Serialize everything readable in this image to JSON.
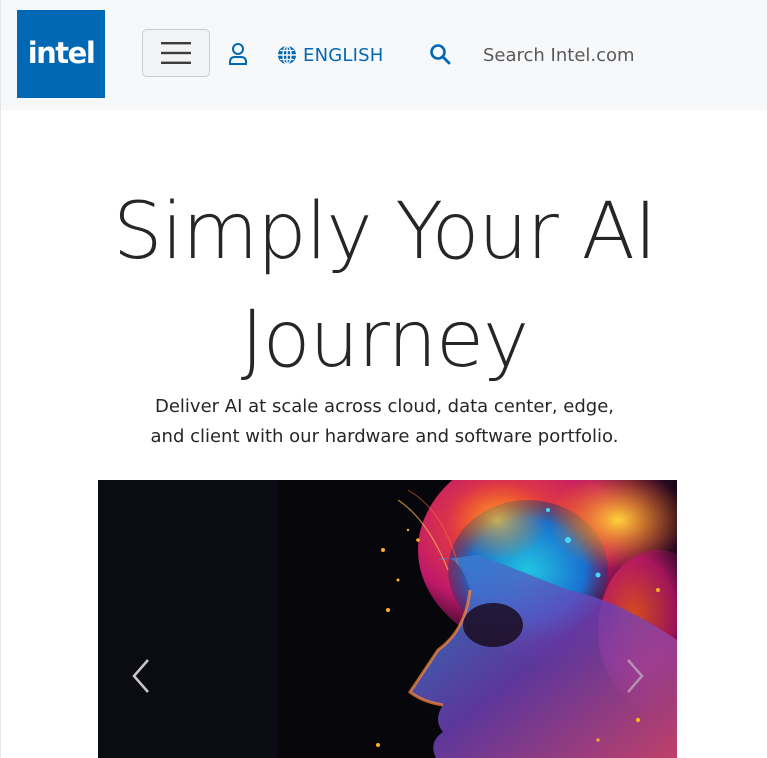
{
  "header": {
    "logo_text": "intel",
    "menu_icon": "hamburger-menu-icon",
    "user_icon": "user-icon",
    "language": {
      "icon": "globe-icon",
      "label": "ENGLISH"
    },
    "search": {
      "icon": "search-icon",
      "placeholder": "Search Intel.com",
      "value": ""
    }
  },
  "hero": {
    "title": "Simply Your AI Journey",
    "subtitle": "Deliver AI at scale across cloud, data center, edge, and client with our hardware and software portfolio."
  },
  "carousel": {
    "prev_icon": "chevron-left-icon",
    "next_icon": "chevron-right-icon"
  },
  "colors": {
    "brand_blue": "#0068b5",
    "header_bg": "#f7f8fa",
    "text": "#262626"
  }
}
